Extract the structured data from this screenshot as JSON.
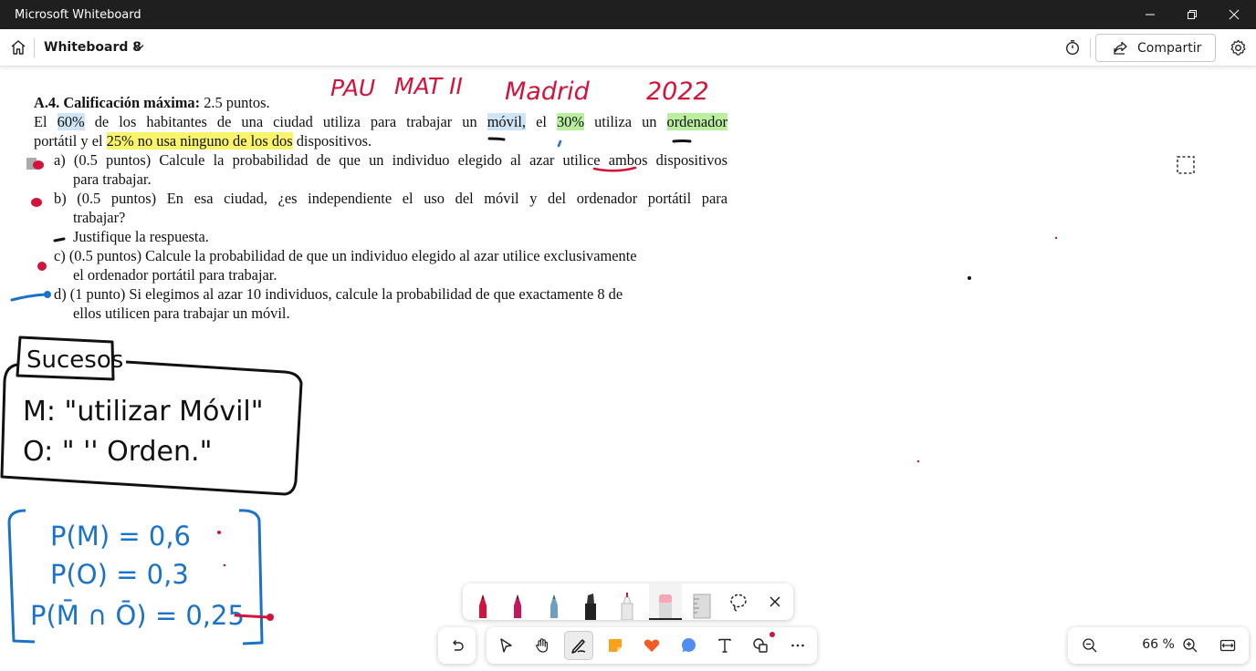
{
  "window": {
    "title": "Microsoft Whiteboard"
  },
  "header": {
    "board_name": "Whiteboard 8",
    "share_label": "Compartir"
  },
  "document": {
    "heading_bold": "A.4. Calificación máxima:",
    "heading_rest": " 2.5 puntos.",
    "intro1": {
      "p1": "El ",
      "h1": "60%",
      "p2": " de los habitantes de una ciudad utiliza para trabajar un ",
      "h2": "móvil,",
      "p3": " el ",
      "h3": "30%",
      "p4": " utiliza un ",
      "h4": "ordenador"
    },
    "intro2": {
      "p1": "portátil y el ",
      "h1": "25% no usa ninguno de los dos",
      "p2": " dispositivos."
    },
    "a1": "a) (0.5 puntos) Calcule la probabilidad de que un individuo elegido al azar utilice ambos dispositivos",
    "a2": "para trabajar.",
    "b1": "b) (0.5 puntos) En esa ciudad, ¿es independiente el uso del móvil y del ordenador portátil para",
    "b2": "trabajar?",
    "b3": "Justifique la respuesta.",
    "c1": "c) (0.5 puntos) Calcule la probabilidad de que un individuo elegido al azar utilice exclusivamente",
    "c2": "el ordenador portátil para trabajar.",
    "d1": "d) (1 punto) Si elegimos al azar 10 individuos, calcule la probabilidad de que exactamente 8 de",
    "d2": "ellos utilicen para trabajar un móvil."
  },
  "handwriting": {
    "title_pau": "PAU",
    "title_mat": "MAT II",
    "title_madrid": "Madrid",
    "title_year": "2022",
    "sucesos": "Sucesos",
    "event_m": "M: \"utilizar Móvil\"",
    "event_o": "O: \"   ''   Orden.\"",
    "prob_m": "P(M) = 0,6",
    "prob_o": "P(O) = 0,3",
    "prob_none": "P(M̄ ∩ Ō) = 0,25"
  },
  "zoom": {
    "level": "66 %"
  },
  "colors": {
    "ink_red": "#d2143c",
    "ink_blue": "#1a73c8",
    "ink_black": "#111111",
    "highlight_blue": "#cfe4f5",
    "highlight_green": "#b9ef9f",
    "highlight_yellow": "#f7f36a",
    "titlebar": "#1f1f1f"
  },
  "pens": [
    "red-pen",
    "magenta-pen",
    "teal-pen",
    "black-marker",
    "highlighter",
    "eraser",
    "ruler",
    "lasso-select",
    "close-tray"
  ],
  "tools": [
    "undo",
    "select",
    "pan",
    "pen",
    "sticky-note",
    "reactions",
    "comment",
    "text",
    "shapes",
    "more"
  ]
}
